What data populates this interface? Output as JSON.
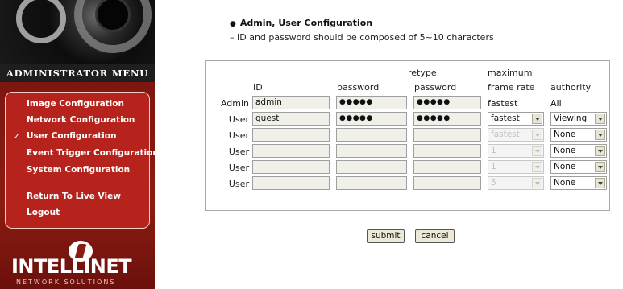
{
  "sidebar": {
    "menu_title": "Administrator Menu",
    "checkmark": "✓",
    "items": [
      {
        "label": "Image Configuration"
      },
      {
        "label": "Network Configuration"
      },
      {
        "label": "User Configuration",
        "selected": true
      },
      {
        "label": "Event Trigger Configuration"
      },
      {
        "label": "System Configuration"
      },
      {
        "label": "Return To Live View"
      },
      {
        "label": "Logout"
      }
    ],
    "brand": {
      "name": "INTELLINET",
      "tagline": "NETWORK SOLUTIONS"
    }
  },
  "main": {
    "bullet": "●",
    "heading": "Admin, User Configuration",
    "subheading": "– ID and password should be composed of 5~10 characters",
    "headers": {
      "id": "ID",
      "password": "password",
      "retype_line1": "retype",
      "retype_line2": "password",
      "maxfr_line1": "maximum",
      "maxfr_line2": "frame rate",
      "authority": "authority"
    },
    "rows": [
      {
        "label": "Admin",
        "id": "admin",
        "password": "●●●●●",
        "retype": "●●●●●",
        "frame_rate": "fastest",
        "authority": "All"
      },
      {
        "label": "User",
        "id": "guest",
        "password": "●●●●●",
        "retype": "●●●●●",
        "frame_rate": "fastest",
        "authority": "Viewing"
      },
      {
        "label": "User",
        "id": "",
        "password": "",
        "retype": "",
        "frame_rate": "fastest",
        "authority": "None"
      },
      {
        "label": "User",
        "id": "",
        "password": "",
        "retype": "",
        "frame_rate": "1",
        "authority": "None"
      },
      {
        "label": "User",
        "id": "",
        "password": "",
        "retype": "",
        "frame_rate": "1",
        "authority": "None"
      },
      {
        "label": "User",
        "id": "",
        "password": "",
        "retype": "",
        "frame_rate": "5",
        "authority": "None"
      }
    ],
    "buttons": {
      "submit": "submit",
      "cancel": "cancel"
    }
  },
  "colors": {
    "sidebar_red": "#b5231c",
    "sidebar_dark": "#7a1410",
    "field_bg": "#f0efe8"
  }
}
